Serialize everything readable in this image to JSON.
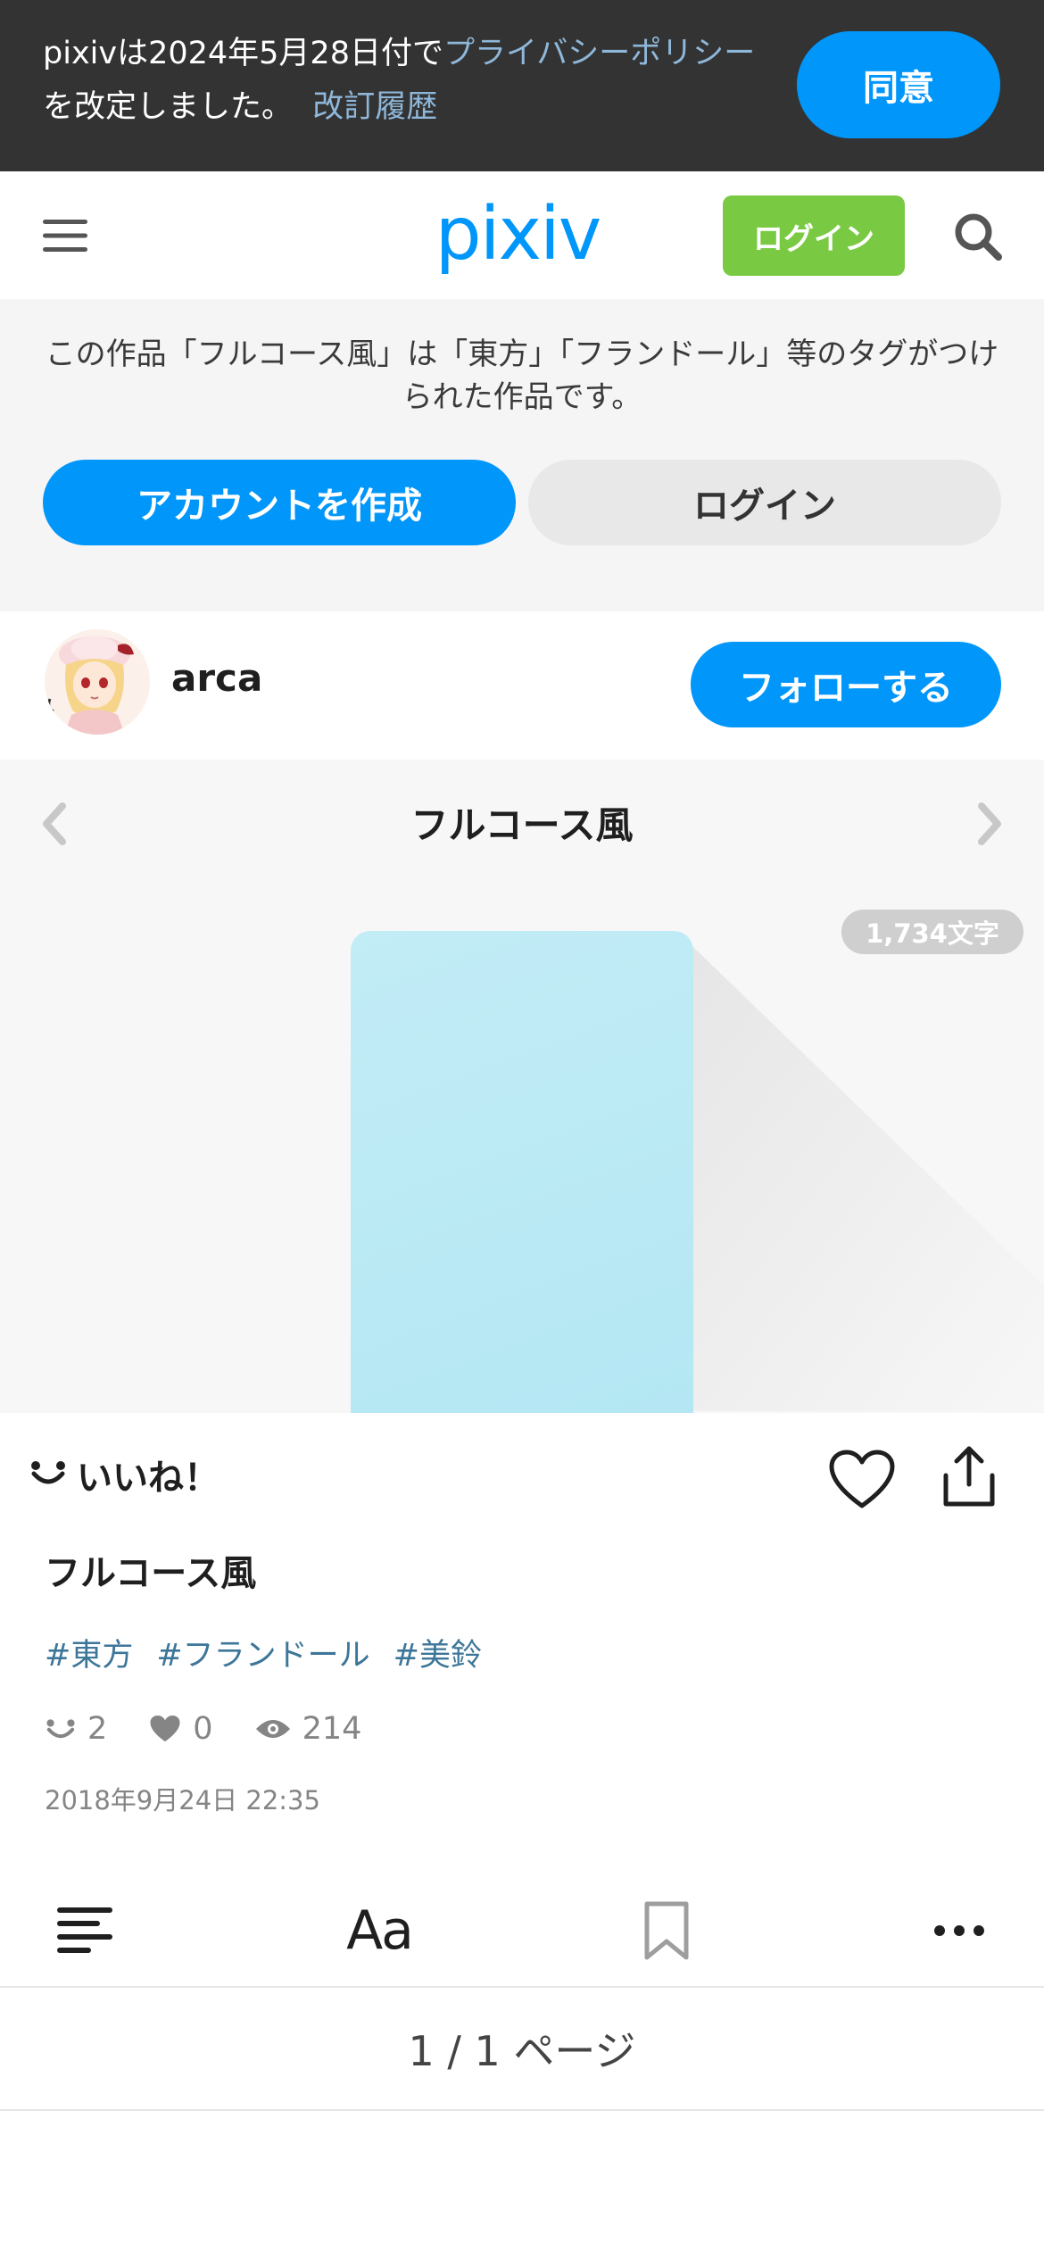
{
  "banner": {
    "text_before": "pixivは2024年5月28日付で",
    "policy_link": "プライバシーポリシー",
    "text_after": "を改定しました。",
    "history_link": "改訂履歴",
    "agree_label": "同意"
  },
  "header": {
    "logo_text": "pixiv",
    "login_label": "ログイン"
  },
  "notice": {
    "message": "この作品「フルコース風」は「東方」「フランドール」等のタグがつけられた作品です。",
    "create_account_label": "アカウントを作成",
    "login_label": "ログイン"
  },
  "author": {
    "name": "arca",
    "follow_label": "フォローする"
  },
  "viewer": {
    "title": "フルコース風",
    "char_count": "1,734文字"
  },
  "actions": {
    "like_label": "いいね！"
  },
  "work": {
    "title": "フルコース風",
    "tags": [
      "#東方",
      "#フランドール",
      "#美鈴"
    ],
    "stats": {
      "likes": "2",
      "bookmarks": "0",
      "views": "214"
    },
    "date": "2018年9月24日 22:35"
  },
  "toolbar": {
    "font_label": "Aa"
  },
  "pagination": {
    "text": "1 / 1 ページ"
  },
  "colors": {
    "accent": "#0096fa",
    "login_green": "#7ac943",
    "banner_bg": "#333333",
    "tag_color": "#3d7699"
  }
}
